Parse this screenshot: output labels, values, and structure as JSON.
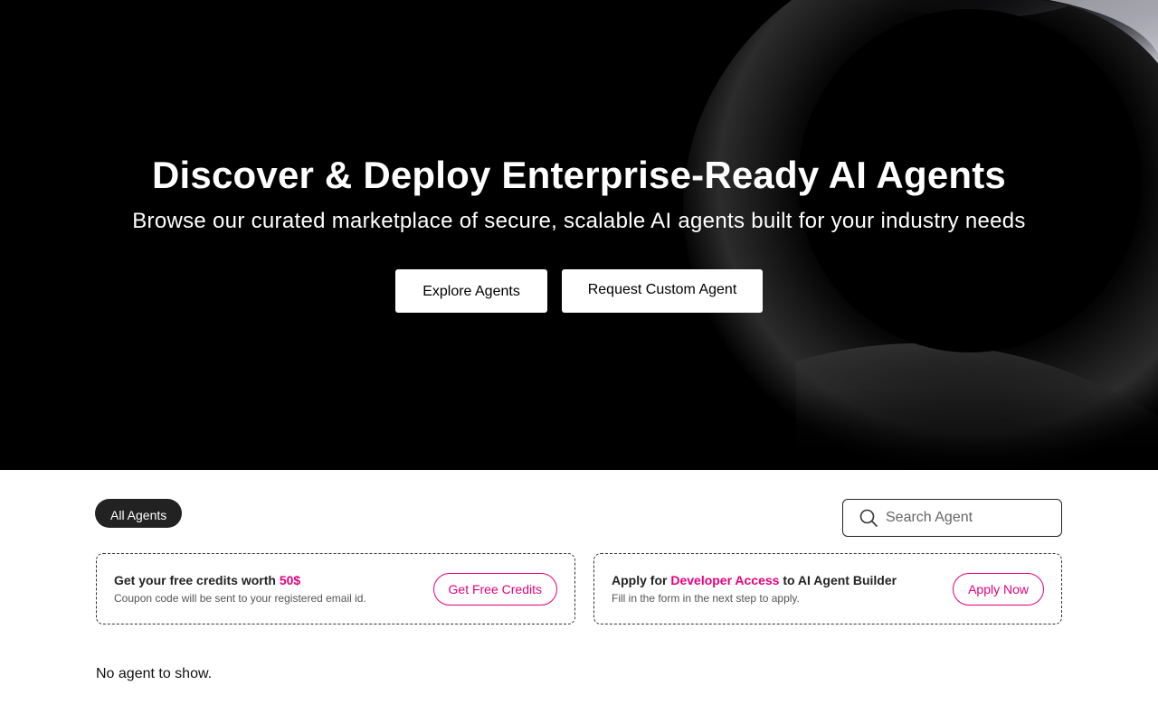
{
  "hero": {
    "title": "Discover & Deploy Enterprise-Ready AI Agents",
    "subtitle": "Browse our curated marketplace of secure, scalable AI agents built for your industry needs",
    "explore_label": "Explore Agents",
    "custom_label": "Request Custom Agent"
  },
  "filters": {
    "active": "All Agents"
  },
  "search": {
    "placeholder": "Search Agent",
    "value": ""
  },
  "promos": {
    "credits": {
      "title_prefix": "Get your free credits worth ",
      "title_highlight": "50$",
      "description": "Coupon code will be sent to your registered email id.",
      "button": "Get Free Credits"
    },
    "developer": {
      "title_prefix": "Apply for ",
      "title_highlight": "Developer Access",
      "title_suffix": " to AI Agent Builder",
      "description": "Fill in the form in the next step to apply.",
      "button": "Apply Now"
    }
  },
  "empty_state": "No agent to show.",
  "colors": {
    "accent": "#e6007e",
    "hero_bg": "#000000",
    "pill_bg": "#222222"
  },
  "icons": {
    "search": "search-icon"
  }
}
